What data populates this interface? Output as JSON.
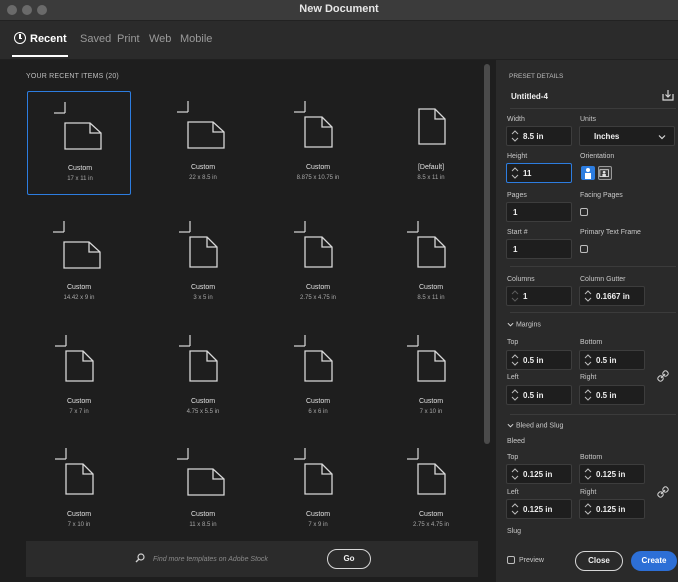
{
  "window": {
    "title": "New Document"
  },
  "tabs": [
    {
      "label": "Recent"
    },
    {
      "label": "Saved"
    },
    {
      "label": "Print"
    },
    {
      "label": "Web"
    },
    {
      "label": "Mobile"
    }
  ],
  "recent": {
    "heading": "YOUR RECENT ITEMS",
    "count": "(20)",
    "items": [
      {
        "name": "Custom",
        "size": "17 x 11 in"
      },
      {
        "name": "Custom",
        "size": "22 x 8.5 in"
      },
      {
        "name": "Custom",
        "size": "8.875 x 10.75 in"
      },
      {
        "name": "[Default]",
        "size": "8.5 x 11 in"
      },
      {
        "name": "Custom",
        "size": "14.42 x 9 in"
      },
      {
        "name": "Custom",
        "size": "3 x 5 in"
      },
      {
        "name": "Custom",
        "size": "2.75 x 4.75 in"
      },
      {
        "name": "Custom",
        "size": "8.5 x 11 in"
      },
      {
        "name": "Custom",
        "size": "7 x 7 in"
      },
      {
        "name": "Custom",
        "size": "4.75 x 5.5 in"
      },
      {
        "name": "Custom",
        "size": "6 x 6 in"
      },
      {
        "name": "Custom",
        "size": "7 x 10 in"
      },
      {
        "name": "Custom",
        "size": "7 x 10 in"
      },
      {
        "name": "Custom",
        "size": "11 x 8.5 in"
      },
      {
        "name": "Custom",
        "size": "7 x 9 in"
      },
      {
        "name": "Custom",
        "size": "2.75 x 4.75 in"
      }
    ]
  },
  "stock": {
    "placeholder": "Find more templates on Adobe Stock",
    "go_label": "Go"
  },
  "preset": {
    "heading": "PRESET DETAILS",
    "name": "Untitled-4",
    "width_label": "Width",
    "width": "8.5 in",
    "units_label": "Units",
    "units": "Inches",
    "height_label": "Height",
    "height": "11",
    "orientation_label": "Orientation",
    "pages_label": "Pages",
    "pages": "1",
    "facing_label": "Facing Pages",
    "start_label": "Start #",
    "start": "1",
    "primary_label": "Primary Text Frame",
    "columns_label": "Columns",
    "columns": "1",
    "gutter_label": "Column Gutter",
    "gutter": "0.1667 in",
    "margins_label": "Margins",
    "m_top_label": "Top",
    "m_top": "0.5 in",
    "m_bottom_label": "Bottom",
    "m_bottom": "0.5 in",
    "m_left_label": "Left",
    "m_left": "0.5 in",
    "m_right_label": "Right",
    "m_right": "0.5 in",
    "bleed_section_label": "Bleed and Slug",
    "bleed_label": "Bleed",
    "b_top_label": "Top",
    "b_top": "0.125 in",
    "b_bottom_label": "Bottom",
    "b_bottom": "0.125 in",
    "b_left_label": "Left",
    "b_left": "0.125 in",
    "b_right_label": "Right",
    "b_right": "0.125 in",
    "slug_label": "Slug"
  },
  "footer": {
    "preview_label": "Preview",
    "close_label": "Close",
    "create_label": "Create"
  },
  "colors": {
    "accent": "#2d7de0",
    "create": "#2d6fd6",
    "background": "#1e1e1e",
    "panel": "#2a2a2a"
  }
}
